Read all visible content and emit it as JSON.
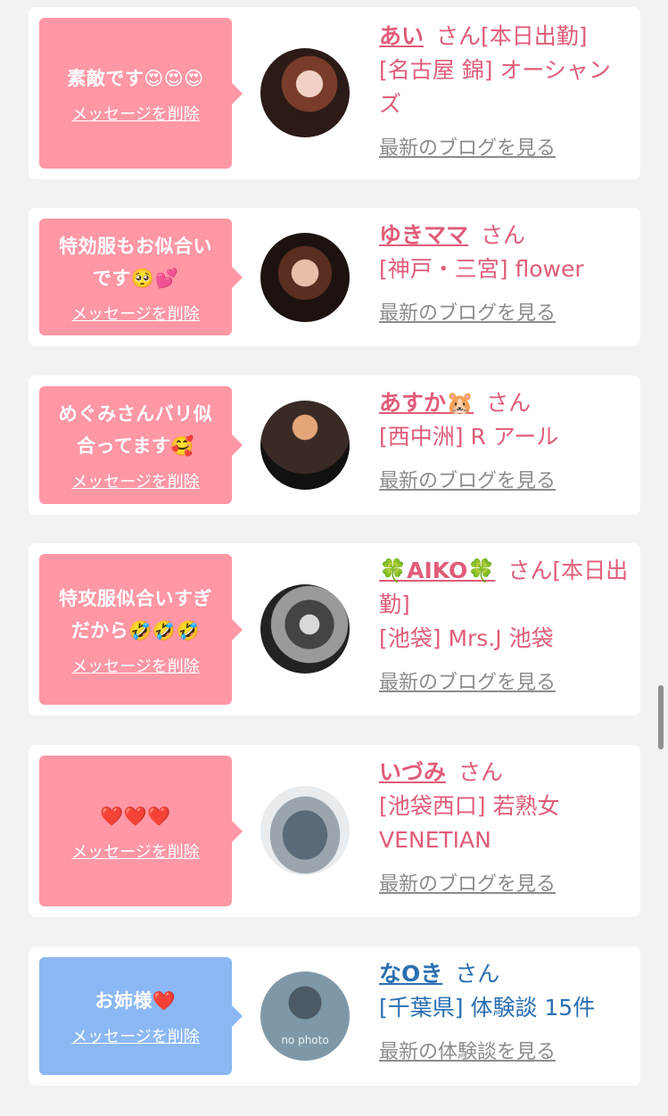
{
  "entries": [
    {
      "message_parts": [
        "素敵です😍😍😍"
      ],
      "delete_label": "メッセージを削除",
      "name": "あい",
      "suffix": "さん[本日出勤]",
      "shop": "[名古屋 錦] オーシャンズ",
      "link": "最新のブログを見る",
      "theme": "pink"
    },
    {
      "message_parts": [
        "特効服もお似合い",
        "です🥺💕"
      ],
      "delete_label": "メッセージを削除",
      "name": "ゆきママ",
      "suffix": "さん",
      "shop": "[神戸・三宮] flower",
      "link": "最新のブログを見る",
      "theme": "pink"
    },
    {
      "message_parts": [
        "めぐみさんバリ似",
        "合ってます🥰"
      ],
      "delete_label": "メッセージを削除",
      "name": "あすか🐹",
      "suffix": "さん",
      "shop": "[西中洲] R アール",
      "link": "最新のブログを見る",
      "theme": "pink"
    },
    {
      "message_parts": [
        "特攻服似合いすぎ",
        "だから🤣🤣🤣"
      ],
      "delete_label": "メッセージを削除",
      "name": "🍀AIKO🍀",
      "suffix": "さん[本日出勤]",
      "shop": "[池袋] Mrs.J 池袋",
      "link": "最新のブログを見る",
      "theme": "pink"
    },
    {
      "message_parts": [
        "❤️❤️❤️"
      ],
      "delete_label": "メッセージを削除",
      "name": "いづみ",
      "suffix": "さん",
      "shop": "[池袋西口] 若熟女 VENETIAN",
      "link": "最新のブログを見る",
      "theme": "pink"
    },
    {
      "message_parts": [
        "お姉様❤️"
      ],
      "delete_label": "メッセージを削除",
      "name": "なOき",
      "suffix": "さん",
      "shop": "[千葉県] 体験談 15件",
      "link": "最新の体験談を見る",
      "theme": "blue",
      "avatar_caption": "no photo"
    }
  ],
  "colors": {
    "pink_bubble": "#ff97a5",
    "blue_bubble": "#8bb8f4",
    "pink_text": "#e05c79",
    "blue_text": "#2a6fb1",
    "link_gray": "#8c8c8c",
    "background": "#f2f2f2"
  }
}
